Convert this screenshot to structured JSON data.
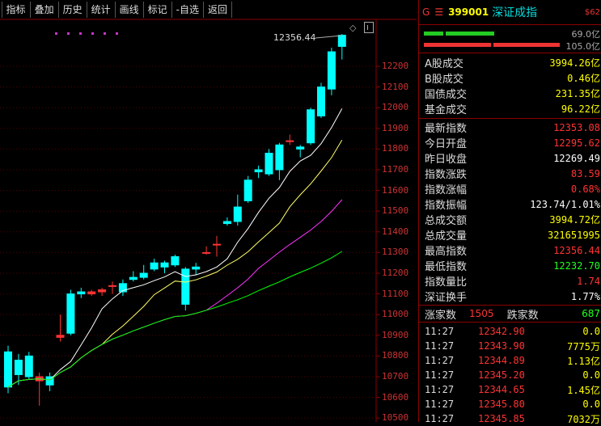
{
  "toolbar": {
    "items": [
      "指标",
      "叠加",
      "历史",
      "统计",
      "画线",
      "标记",
      "-自选",
      "返回"
    ]
  },
  "chart": {
    "high_label": "12356.44",
    "y_ticks": [
      "12200",
      "12100",
      "12000",
      "11900",
      "11800",
      "11700",
      "11600",
      "11500",
      "11400",
      "11300",
      "11200",
      "11100",
      "11000",
      "10900",
      "10800",
      "10700",
      "10600",
      "10500"
    ],
    "candles": [
      {
        "o": 10820,
        "h": 10850,
        "l": 10620,
        "c": 10650
      },
      {
        "o": 10780,
        "h": 10810,
        "l": 10660,
        "c": 10710
      },
      {
        "o": 10800,
        "h": 10820,
        "l": 10690,
        "c": 10700
      },
      {
        "o": 10680,
        "h": 10720,
        "l": 10560,
        "c": 10700
      },
      {
        "o": 10700,
        "h": 10720,
        "l": 10630,
        "c": 10660
      },
      {
        "o": 10890,
        "h": 11000,
        "l": 10870,
        "c": 10900
      },
      {
        "o": 11100,
        "h": 11120,
        "l": 10900,
        "c": 10910
      },
      {
        "o": 11110,
        "h": 11130,
        "l": 11080,
        "c": 11100
      },
      {
        "o": 11100,
        "h": 11120,
        "l": 11090,
        "c": 11110
      },
      {
        "o": 11110,
        "h": 11130,
        "l": 11090,
        "c": 11120
      },
      {
        "o": 11140,
        "h": 11160,
        "l": 11100,
        "c": 11140
      },
      {
        "o": 11150,
        "h": 11170,
        "l": 11090,
        "c": 11110
      },
      {
        "o": 11180,
        "h": 11210,
        "l": 11160,
        "c": 11170
      },
      {
        "o": 11200,
        "h": 11240,
        "l": 11170,
        "c": 11180
      },
      {
        "o": 11250,
        "h": 11270,
        "l": 11210,
        "c": 11220
      },
      {
        "o": 11250,
        "h": 11260,
        "l": 11200,
        "c": 11230
      },
      {
        "o": 11280,
        "h": 11290,
        "l": 11230,
        "c": 11240
      },
      {
        "o": 11220,
        "h": 11230,
        "l": 11020,
        "c": 11050
      },
      {
        "o": 11230,
        "h": 11250,
        "l": 11190,
        "c": 11220
      },
      {
        "o": 11300,
        "h": 11330,
        "l": 11290,
        "c": 11300
      },
      {
        "o": 11340,
        "h": 11380,
        "l": 11280,
        "c": 11340
      },
      {
        "o": 11450,
        "h": 11470,
        "l": 11430,
        "c": 11440
      },
      {
        "o": 11520,
        "h": 11580,
        "l": 11430,
        "c": 11450
      },
      {
        "o": 11650,
        "h": 11670,
        "l": 11540,
        "c": 11550
      },
      {
        "o": 11700,
        "h": 11720,
        "l": 11660,
        "c": 11690
      },
      {
        "o": 11780,
        "h": 11800,
        "l": 11670,
        "c": 11680
      },
      {
        "o": 11820,
        "h": 11830,
        "l": 11650,
        "c": 11700
      },
      {
        "o": 11840,
        "h": 11870,
        "l": 11820,
        "c": 11840
      },
      {
        "o": 11810,
        "h": 11820,
        "l": 11760,
        "c": 11800
      },
      {
        "o": 11990,
        "h": 12000,
        "l": 11820,
        "c": 11830
      },
      {
        "o": 12100,
        "h": 12120,
        "l": 11950,
        "c": 11960
      },
      {
        "o": 12270,
        "h": 12290,
        "l": 12060,
        "c": 12090
      },
      {
        "o": 12350,
        "h": 12356,
        "l": 12233,
        "c": 12296
      }
    ],
    "colors": {
      "up": "#ff3333",
      "down": "#00ffff",
      "ma5": "#ffffff",
      "ma10": "#ffff66",
      "ma20": "#ff33ff",
      "ma60": "#00ff00"
    }
  },
  "panel": {
    "code": "399001",
    "name": "深证成指",
    "prefix": "G",
    "menu_icon": "menu-icon",
    "badge": "$62",
    "vol_up": "69.0亿",
    "vol_down": "105.0亿",
    "rows_a": [
      {
        "label": "A股成交",
        "value": "3994.26亿",
        "color": "yellow"
      },
      {
        "label": "B股成交",
        "value": "0.46亿",
        "color": "yellow"
      },
      {
        "label": "国债成交",
        "value": "231.35亿",
        "color": "yellow"
      },
      {
        "label": "基金成交",
        "value": "96.22亿",
        "color": "yellow"
      }
    ],
    "rows_b": [
      {
        "label": "最新指数",
        "value": "12353.08",
        "color": "red"
      },
      {
        "label": "今日开盘",
        "value": "12295.62",
        "color": "red"
      },
      {
        "label": "昨日收盘",
        "value": "12269.49",
        "color": "white"
      },
      {
        "label": "指数涨跌",
        "value": "83.59",
        "color": "red"
      },
      {
        "label": "指数涨幅",
        "value": "0.68%",
        "color": "red"
      },
      {
        "label": "指数振幅",
        "value": "123.74/1.01%",
        "color": "white"
      },
      {
        "label": "总成交额",
        "value": "3994.72亿",
        "color": "yellow"
      },
      {
        "label": "总成交量",
        "value": "321651995",
        "color": "yellow"
      },
      {
        "label": "最高指数",
        "value": "12356.44",
        "color": "red"
      },
      {
        "label": "最低指数",
        "value": "12232.70",
        "color": "green"
      },
      {
        "label": "指数量比",
        "value": "1.74",
        "color": "red"
      },
      {
        "label": "深证换手",
        "value": "1.77%",
        "color": "white"
      }
    ],
    "updown": {
      "up_label": "涨家数",
      "up_value": "1505",
      "down_label": "跌家数",
      "down_value": "687"
    },
    "ticks": [
      {
        "time": "11:27",
        "price": "12342.90",
        "vol": "0.0"
      },
      {
        "time": "11:27",
        "price": "12343.90",
        "vol": "7775万"
      },
      {
        "time": "11:27",
        "price": "12344.89",
        "vol": "1.13亿"
      },
      {
        "time": "11:27",
        "price": "12345.20",
        "vol": "0.0"
      },
      {
        "time": "11:27",
        "price": "12344.65",
        "vol": "1.45亿"
      },
      {
        "time": "11:27",
        "price": "12345.80",
        "vol": "0.0"
      },
      {
        "time": "11:27",
        "price": "12345.85",
        "vol": "7032万"
      }
    ]
  }
}
